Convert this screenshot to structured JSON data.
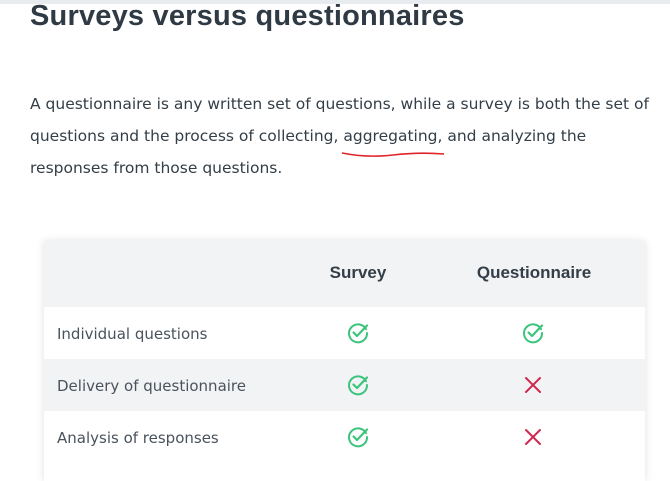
{
  "article": {
    "heading": "Surveys versus questionnaires",
    "paragraph_before": "A questionnaire is any written set of questions, while a survey is both the set of questions and the process of collecting, ",
    "paragraph_underlined": "aggregating",
    "paragraph_after": ", and analyzing the responses from those questions."
  },
  "table": {
    "columns": [
      "",
      "Survey",
      "Questionnaire"
    ],
    "rows": [
      {
        "label": "Individual questions",
        "survey": "check",
        "questionnaire": "check"
      },
      {
        "label": "Delivery of questionnaire",
        "survey": "check",
        "questionnaire": "cross"
      },
      {
        "label": "Analysis of responses",
        "survey": "check",
        "questionnaire": "cross"
      }
    ]
  },
  "colors": {
    "check": "#3cc47c",
    "cross": "#d1284f",
    "spellcheck_underline": "#e0242a",
    "heading": "#2f3a44",
    "header_row_bg": "#f2f3f4"
  },
  "icons": {
    "check": "check-circle-icon",
    "cross": "x-mark-icon"
  }
}
